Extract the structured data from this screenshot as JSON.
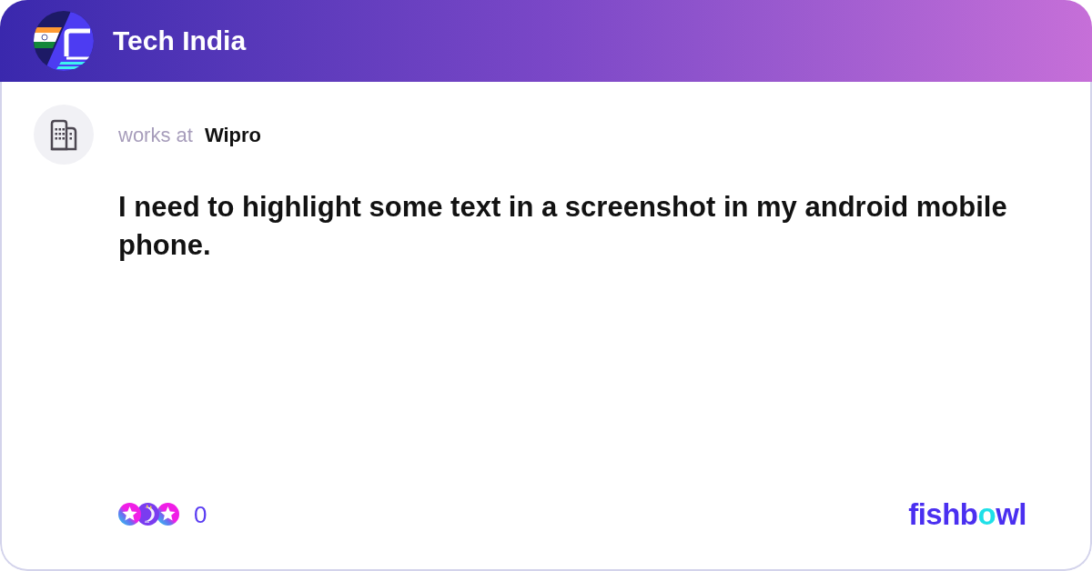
{
  "header": {
    "title": "Tech India"
  },
  "author": {
    "label": "works at",
    "company": "Wipro"
  },
  "post": {
    "text": "I need to highlight some text in a screenshot in my android mobile phone."
  },
  "footer": {
    "reaction_count": "0",
    "brand": [
      {
        "text": "fishb",
        "color": "#4a2ff0"
      },
      {
        "text": "o",
        "color": "#1fe0e8"
      },
      {
        "text": "wl",
        "color": "#4a2ff0"
      }
    ]
  }
}
